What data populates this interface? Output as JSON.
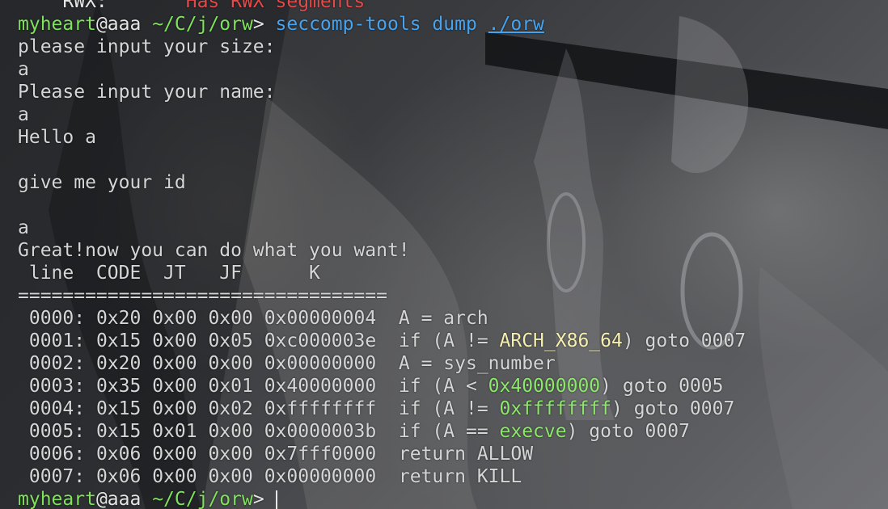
{
  "prompt": {
    "user": "myheart",
    "at": "@",
    "host": "aaa",
    "path": "~/C/j/orw",
    "arrow": ">"
  },
  "rwx_line": {
    "label": "RWX:",
    "value": "Has RWX segments"
  },
  "command": {
    "tool": "seccomp-tools",
    "subcommand": "dump",
    "target": "./orw"
  },
  "output_lines": [
    "please input your size:",
    "a",
    "Please input your name:",
    "a",
    "Hello a",
    "",
    "give me your id",
    "",
    "a",
    "Great!now you can do what you want!"
  ],
  "dump_header": " line  CODE  JT   JF      K",
  "dump_separator": "=================================",
  "rules": [
    {
      "addr": "0000",
      "code": "0x20",
      "jt": "0x00",
      "jf": "0x00",
      "k": "0x00000004",
      "pre": "A = arch",
      "hl": "",
      "post": ""
    },
    {
      "addr": "0001",
      "code": "0x15",
      "jt": "0x00",
      "jf": "0x05",
      "k": "0xc000003e",
      "pre": "if (A != ",
      "hl": "ARCH_X86_64",
      "post": ") goto 0007",
      "hl_color": "#f6f0b0"
    },
    {
      "addr": "0002",
      "code": "0x20",
      "jt": "0x00",
      "jf": "0x00",
      "k": "0x00000000",
      "pre": "A = sys_number",
      "hl": "",
      "post": ""
    },
    {
      "addr": "0003",
      "code": "0x35",
      "jt": "0x00",
      "jf": "0x01",
      "k": "0x40000000",
      "pre": "if (A < ",
      "hl": "0x40000000",
      "post": ") goto 0005",
      "hl_color": "#8ce86b"
    },
    {
      "addr": "0004",
      "code": "0x15",
      "jt": "0x00",
      "jf": "0x02",
      "k": "0xffffffff",
      "pre": "if (A != ",
      "hl": "0xffffffff",
      "post": ") goto 0007",
      "hl_color": "#8ce86b"
    },
    {
      "addr": "0005",
      "code": "0x15",
      "jt": "0x01",
      "jf": "0x00",
      "k": "0x0000003b",
      "pre": "if (A == ",
      "hl": "execve",
      "post": ") goto 0007",
      "hl_color": "#8ce86b"
    },
    {
      "addr": "0006",
      "code": "0x06",
      "jt": "0x00",
      "jf": "0x00",
      "k": "0x7fff0000",
      "pre": "return ALLOW",
      "hl": "",
      "post": ""
    },
    {
      "addr": "0007",
      "code": "0x06",
      "jt": "0x00",
      "jf": "0x00",
      "k": "0x00000000",
      "pre": "return KILL",
      "hl": "",
      "post": ""
    }
  ],
  "colors": {
    "prompt_green": "#7fe25c",
    "command_blue": "#45a3f0",
    "rwx_red": "#e34a4a",
    "text": "#d6d6d6"
  }
}
